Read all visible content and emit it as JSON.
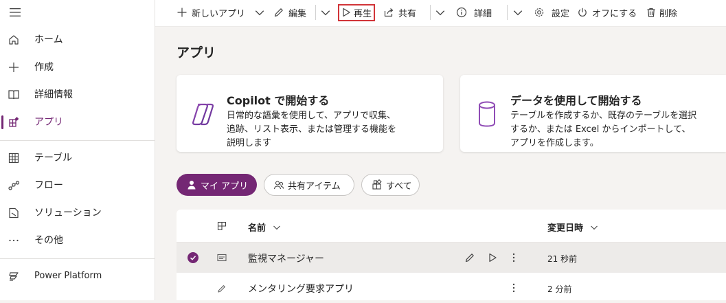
{
  "sidebar": {
    "items": [
      {
        "label": "ホーム",
        "icon": "home-icon"
      },
      {
        "label": "作成",
        "icon": "plus-icon"
      },
      {
        "label": "詳細情報",
        "icon": "book-icon"
      },
      {
        "label": "アプリ",
        "icon": "apps-icon"
      },
      {
        "label": "テーブル",
        "icon": "table-icon"
      },
      {
        "label": "フロー",
        "icon": "flow-icon"
      },
      {
        "label": "ソリューション",
        "icon": "solution-icon"
      },
      {
        "label": "その他",
        "icon": "more-icon"
      },
      {
        "label": "Power Platform",
        "icon": "power-platform-icon"
      }
    ],
    "active": "アプリ"
  },
  "toolbar": {
    "new_app": "新しいアプリ",
    "edit": "編集",
    "play": "再生",
    "share": "共有",
    "details": "詳細",
    "settings": "設定",
    "turn_off": "オフにする",
    "delete": "削除"
  },
  "page": {
    "title": "アプリ"
  },
  "cards": [
    {
      "title": "Copilot で開始する",
      "lines": [
        "日常的な語彙を使用して、アプリで収集、",
        "追跡、リスト表示、または管理する機能を",
        "説明します"
      ],
      "icon": "copilot-icon"
    },
    {
      "title": "データを使用して開始する",
      "lines": [
        "テーブルを作成するか、既存のテーブルを選択",
        "するか、または Excel からインポートして、",
        "アプリを作成します。"
      ],
      "icon": "database-icon"
    }
  ],
  "filters": [
    {
      "label": "マイ アプリ",
      "active": true
    },
    {
      "label": "共有アイテム",
      "active": false
    },
    {
      "label": "すべて",
      "active": false
    }
  ],
  "table": {
    "columns": {
      "name": "名前",
      "modified": "変更日時"
    },
    "rows": [
      {
        "name": "監視マネージャー",
        "modified": "21 秒前",
        "selected": true
      },
      {
        "name": "メンタリング要求アプリ",
        "modified": "2 分前",
        "selected": false
      }
    ]
  },
  "colors": {
    "accent": "#742774",
    "highlight": "#d13438"
  }
}
